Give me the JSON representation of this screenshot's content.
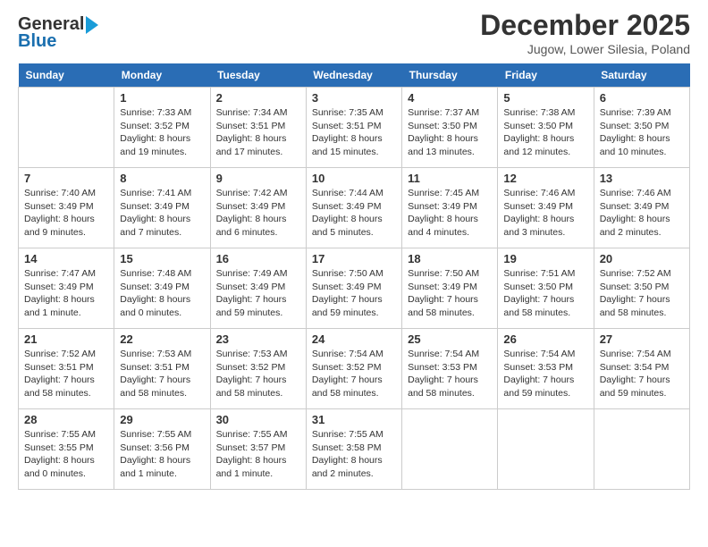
{
  "header": {
    "logo_general": "General",
    "logo_blue": "Blue",
    "month": "December 2025",
    "location": "Jugow, Lower Silesia, Poland"
  },
  "days_of_week": [
    "Sunday",
    "Monday",
    "Tuesday",
    "Wednesday",
    "Thursday",
    "Friday",
    "Saturday"
  ],
  "weeks": [
    [
      {
        "day": "",
        "sunrise": "",
        "sunset": "",
        "daylight": ""
      },
      {
        "day": "1",
        "sunrise": "Sunrise: 7:33 AM",
        "sunset": "Sunset: 3:52 PM",
        "daylight": "Daylight: 8 hours and 19 minutes."
      },
      {
        "day": "2",
        "sunrise": "Sunrise: 7:34 AM",
        "sunset": "Sunset: 3:51 PM",
        "daylight": "Daylight: 8 hours and 17 minutes."
      },
      {
        "day": "3",
        "sunrise": "Sunrise: 7:35 AM",
        "sunset": "Sunset: 3:51 PM",
        "daylight": "Daylight: 8 hours and 15 minutes."
      },
      {
        "day": "4",
        "sunrise": "Sunrise: 7:37 AM",
        "sunset": "Sunset: 3:50 PM",
        "daylight": "Daylight: 8 hours and 13 minutes."
      },
      {
        "day": "5",
        "sunrise": "Sunrise: 7:38 AM",
        "sunset": "Sunset: 3:50 PM",
        "daylight": "Daylight: 8 hours and 12 minutes."
      },
      {
        "day": "6",
        "sunrise": "Sunrise: 7:39 AM",
        "sunset": "Sunset: 3:50 PM",
        "daylight": "Daylight: 8 hours and 10 minutes."
      }
    ],
    [
      {
        "day": "7",
        "sunrise": "Sunrise: 7:40 AM",
        "sunset": "Sunset: 3:49 PM",
        "daylight": "Daylight: 8 hours and 9 minutes."
      },
      {
        "day": "8",
        "sunrise": "Sunrise: 7:41 AM",
        "sunset": "Sunset: 3:49 PM",
        "daylight": "Daylight: 8 hours and 7 minutes."
      },
      {
        "day": "9",
        "sunrise": "Sunrise: 7:42 AM",
        "sunset": "Sunset: 3:49 PM",
        "daylight": "Daylight: 8 hours and 6 minutes."
      },
      {
        "day": "10",
        "sunrise": "Sunrise: 7:44 AM",
        "sunset": "Sunset: 3:49 PM",
        "daylight": "Daylight: 8 hours and 5 minutes."
      },
      {
        "day": "11",
        "sunrise": "Sunrise: 7:45 AM",
        "sunset": "Sunset: 3:49 PM",
        "daylight": "Daylight: 8 hours and 4 minutes."
      },
      {
        "day": "12",
        "sunrise": "Sunrise: 7:46 AM",
        "sunset": "Sunset: 3:49 PM",
        "daylight": "Daylight: 8 hours and 3 minutes."
      },
      {
        "day": "13",
        "sunrise": "Sunrise: 7:46 AM",
        "sunset": "Sunset: 3:49 PM",
        "daylight": "Daylight: 8 hours and 2 minutes."
      }
    ],
    [
      {
        "day": "14",
        "sunrise": "Sunrise: 7:47 AM",
        "sunset": "Sunset: 3:49 PM",
        "daylight": "Daylight: 8 hours and 1 minute."
      },
      {
        "day": "15",
        "sunrise": "Sunrise: 7:48 AM",
        "sunset": "Sunset: 3:49 PM",
        "daylight": "Daylight: 8 hours and 0 minutes."
      },
      {
        "day": "16",
        "sunrise": "Sunrise: 7:49 AM",
        "sunset": "Sunset: 3:49 PM",
        "daylight": "Daylight: 7 hours and 59 minutes."
      },
      {
        "day": "17",
        "sunrise": "Sunrise: 7:50 AM",
        "sunset": "Sunset: 3:49 PM",
        "daylight": "Daylight: 7 hours and 59 minutes."
      },
      {
        "day": "18",
        "sunrise": "Sunrise: 7:50 AM",
        "sunset": "Sunset: 3:49 PM",
        "daylight": "Daylight: 7 hours and 58 minutes."
      },
      {
        "day": "19",
        "sunrise": "Sunrise: 7:51 AM",
        "sunset": "Sunset: 3:50 PM",
        "daylight": "Daylight: 7 hours and 58 minutes."
      },
      {
        "day": "20",
        "sunrise": "Sunrise: 7:52 AM",
        "sunset": "Sunset: 3:50 PM",
        "daylight": "Daylight: 7 hours and 58 minutes."
      }
    ],
    [
      {
        "day": "21",
        "sunrise": "Sunrise: 7:52 AM",
        "sunset": "Sunset: 3:51 PM",
        "daylight": "Daylight: 7 hours and 58 minutes."
      },
      {
        "day": "22",
        "sunrise": "Sunrise: 7:53 AM",
        "sunset": "Sunset: 3:51 PM",
        "daylight": "Daylight: 7 hours and 58 minutes."
      },
      {
        "day": "23",
        "sunrise": "Sunrise: 7:53 AM",
        "sunset": "Sunset: 3:52 PM",
        "daylight": "Daylight: 7 hours and 58 minutes."
      },
      {
        "day": "24",
        "sunrise": "Sunrise: 7:54 AM",
        "sunset": "Sunset: 3:52 PM",
        "daylight": "Daylight: 7 hours and 58 minutes."
      },
      {
        "day": "25",
        "sunrise": "Sunrise: 7:54 AM",
        "sunset": "Sunset: 3:53 PM",
        "daylight": "Daylight: 7 hours and 58 minutes."
      },
      {
        "day": "26",
        "sunrise": "Sunrise: 7:54 AM",
        "sunset": "Sunset: 3:53 PM",
        "daylight": "Daylight: 7 hours and 59 minutes."
      },
      {
        "day": "27",
        "sunrise": "Sunrise: 7:54 AM",
        "sunset": "Sunset: 3:54 PM",
        "daylight": "Daylight: 7 hours and 59 minutes."
      }
    ],
    [
      {
        "day": "28",
        "sunrise": "Sunrise: 7:55 AM",
        "sunset": "Sunset: 3:55 PM",
        "daylight": "Daylight: 8 hours and 0 minutes."
      },
      {
        "day": "29",
        "sunrise": "Sunrise: 7:55 AM",
        "sunset": "Sunset: 3:56 PM",
        "daylight": "Daylight: 8 hours and 1 minute."
      },
      {
        "day": "30",
        "sunrise": "Sunrise: 7:55 AM",
        "sunset": "Sunset: 3:57 PM",
        "daylight": "Daylight: 8 hours and 1 minute."
      },
      {
        "day": "31",
        "sunrise": "Sunrise: 7:55 AM",
        "sunset": "Sunset: 3:58 PM",
        "daylight": "Daylight: 8 hours and 2 minutes."
      },
      {
        "day": "",
        "sunrise": "",
        "sunset": "",
        "daylight": ""
      },
      {
        "day": "",
        "sunrise": "",
        "sunset": "",
        "daylight": ""
      },
      {
        "day": "",
        "sunrise": "",
        "sunset": "",
        "daylight": ""
      }
    ]
  ]
}
